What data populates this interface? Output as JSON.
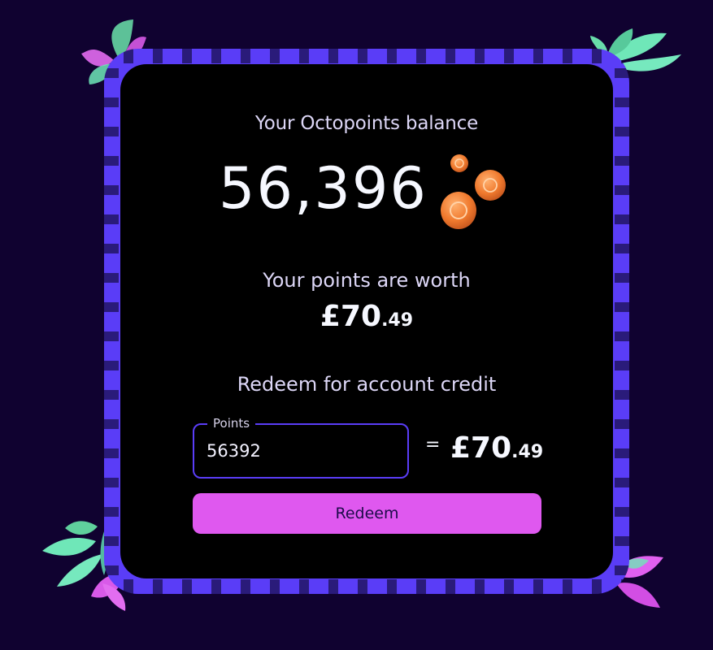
{
  "balance": {
    "label": "Your Octopoints balance",
    "value": "56,396",
    "coin_icon": "coins-icon"
  },
  "worth": {
    "label": "Your points are worth",
    "currency": "£70",
    "pence": ".49"
  },
  "redeem": {
    "heading": "Redeem for account credit",
    "input_label": "Points",
    "input_value": "56392",
    "equals": "=",
    "credit_currency": "£70",
    "credit_pence": ".49",
    "button_label": "Redeem"
  },
  "colors": {
    "background": "#100230",
    "card": "#000000",
    "frame": "#5a3df7",
    "button": "#df58ef",
    "text": "#f6f8ff"
  }
}
